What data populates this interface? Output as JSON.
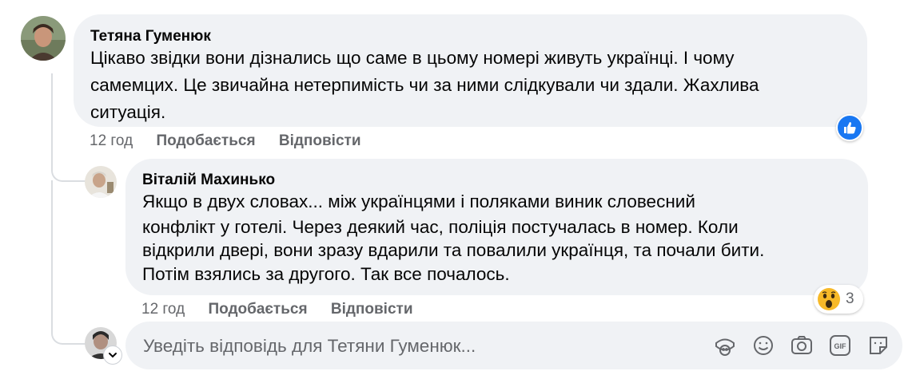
{
  "comments": [
    {
      "author": "Тетяна Гуменюк",
      "lines": [
        "Цікаво звідки вони дізнались що саме в цьому номері живуть українці. І чому",
        "самемцих. Це звичайна нетерпимість чи за ними слідкували чи здали. Жахлива",
        "ситуація."
      ],
      "time": "12 год",
      "like_label": "Подобається",
      "reply_label": "Відповісти",
      "reaction": "like-icon"
    },
    {
      "author": "Віталій Махинько",
      "lines": [
        "Якщо в двух словах... між українцями і поляками виник словесний",
        "конфлікт у готелі. Через деякий час, поліція постучалась в номер. Коли",
        "відкрили двері, вони зразу вдарили та повалили українця, та почали бити.",
        "Потім взялись за другого. Так все почалось."
      ],
      "time": "12 год",
      "like_label": "Подобається",
      "reply_label": "Відповісти",
      "reaction": "wow-icon",
      "reaction_count": "3"
    }
  ],
  "reply_box": {
    "placeholder": "Уведіть відповідь для Тетяни Гуменюк..."
  },
  "tools": [
    "avatar-sticker-icon",
    "emoji-icon",
    "camera-icon",
    "gif-icon",
    "sticker-icon"
  ],
  "colors": {
    "bubble": "#f0f2f5",
    "meta_text": "#65676b",
    "like_blue": "#1877f2",
    "wow_yellow": "#f7b928"
  }
}
